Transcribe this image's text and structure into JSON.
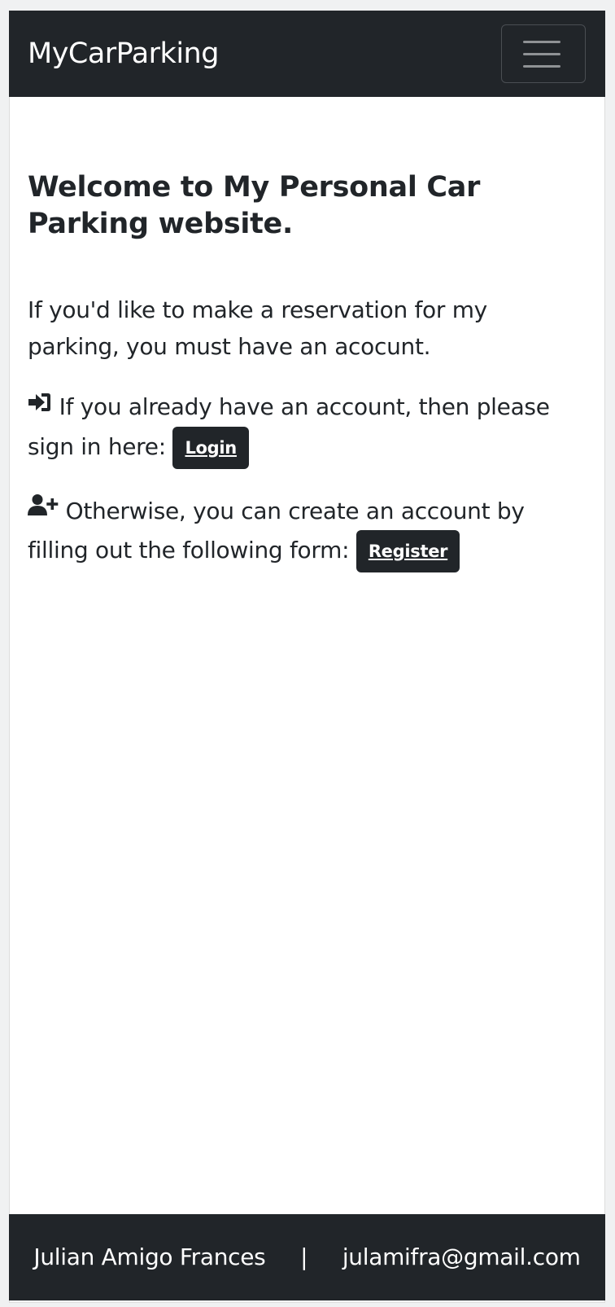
{
  "navbar": {
    "brand": "MyCarParking",
    "toggler_icon": "hamburger-menu-icon"
  },
  "main": {
    "heading": "Welcome to My Personal Car Parking website.",
    "intro": "If you'd like to make a reservation for my parking, you must have an acocunt.",
    "login_text": "If you already have an account, then please sign in here:",
    "login_icon": "sign-in-icon",
    "login_button": "Login",
    "register_text": "Otherwise, you can create an account by filling out the following form:",
    "register_icon": "user-plus-icon",
    "register_button": "Register"
  },
  "footer": {
    "name": "Julian Amigo Frances",
    "separator": "|",
    "email": "julamifra@gmail.com"
  },
  "colors": {
    "dark": "#212529",
    "text": "#212529",
    "background": "#ffffff"
  }
}
